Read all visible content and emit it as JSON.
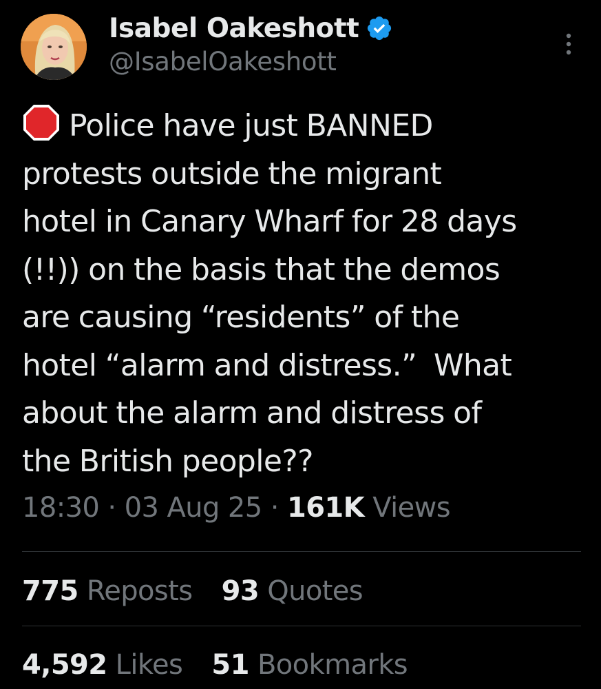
{
  "author": {
    "display_name": "Isabel Oakeshott",
    "handle": "@IsabelOakeshott",
    "verified": true,
    "avatar_icon": "profile-photo",
    "verified_color": "#1d9bf0"
  },
  "tweet": {
    "leading_icon": "stop-sign-icon",
    "text": "Police have just BANNED protests outside the migrant hotel in Canary Wharf for 28 days (!!)) on the basis that the demos are causing “residents” of the hotel “alarm and distress.”  What about the alarm and distress of the British people??",
    "text_lines": [
      "Police have just BANNED",
      "protests outside the migrant",
      "hotel in Canary Wharf for 28 days",
      "(!!)) on the basis that the demos",
      "are causing “residents” of the",
      "hotel “alarm and distress.”  What",
      "about the alarm and distress of",
      "the British people??"
    ]
  },
  "meta": {
    "time": "18:30",
    "separator": "·",
    "date": "03 Aug 25",
    "views_count": "161K",
    "views_label": "Views"
  },
  "stats": {
    "reposts_count": "775",
    "reposts_label": "Reposts",
    "quotes_count": "93",
    "quotes_label": "Quotes",
    "likes_count": "4,592",
    "likes_label": "Likes",
    "bookmarks_count": "51",
    "bookmarks_label": "Bookmarks"
  },
  "colors": {
    "background": "#000000",
    "text_primary": "#e7e9ea",
    "text_secondary": "#71767b",
    "divider": "#2f3336"
  }
}
